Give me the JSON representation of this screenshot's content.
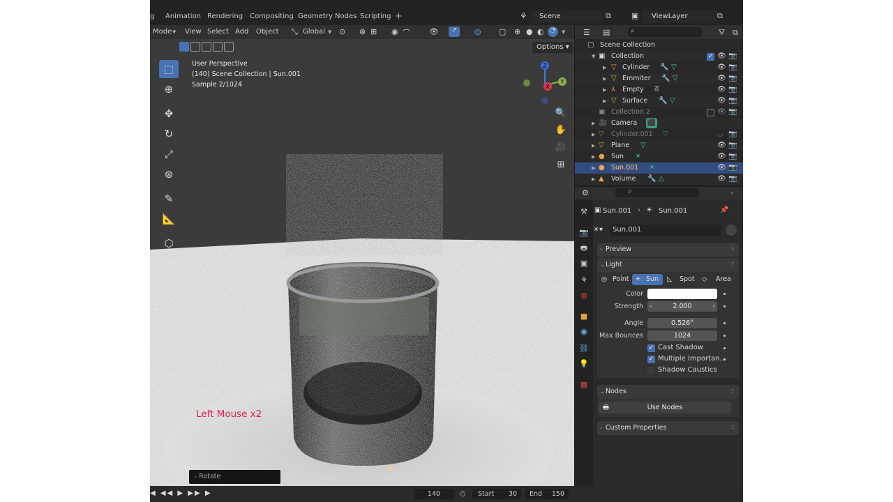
{
  "topbar": {
    "tabs": [
      "g",
      "Animation",
      "Rendering",
      "Compositing",
      "Geometry Nodes",
      "Scripting"
    ],
    "plus": "+",
    "scene": "Scene",
    "view_layer": "ViewLayer"
  },
  "viewport_header": {
    "mode": "Mode",
    "menus": [
      "View",
      "Select",
      "Add",
      "Object"
    ],
    "orientation": "Global",
    "options": "Options"
  },
  "viewport": {
    "perspective": "User Perspective",
    "collection_info": "(140) Scene Collection | Sun.001",
    "sample": "Sample 2/1024",
    "keystroke": "Left Mouse x2",
    "last_operator": "Rotate",
    "gizmo": {
      "z": "Z",
      "y": "Y",
      "x": "X"
    }
  },
  "timeline": {
    "current_frame": "140",
    "start_label": "Start",
    "start_value": "30",
    "end_label": "End",
    "end_value": "150"
  },
  "outliner": {
    "root": "Scene Collection",
    "rows": [
      {
        "name": "Collection",
        "level": 1,
        "type": "collection"
      },
      {
        "name": "Cylinder",
        "level": 2,
        "type": "mesh"
      },
      {
        "name": "Emmiter",
        "level": 2,
        "type": "mesh"
      },
      {
        "name": "Empty",
        "level": 2,
        "type": "empty"
      },
      {
        "name": "Surface",
        "level": 2,
        "type": "mesh"
      },
      {
        "name": "Collection 2",
        "level": 1,
        "type": "collection-dim"
      },
      {
        "name": "Camera",
        "level": 1,
        "type": "camera"
      },
      {
        "name": "Cylinder.001",
        "level": 1,
        "type": "mesh-dim"
      },
      {
        "name": "Plane",
        "level": 1,
        "type": "mesh"
      },
      {
        "name": "Sun",
        "level": 1,
        "type": "light"
      },
      {
        "name": "Sun.001",
        "level": 1,
        "type": "light-selected"
      },
      {
        "name": "Volume",
        "level": 1,
        "type": "mesh"
      }
    ]
  },
  "properties": {
    "breadcrumb_object": "Sun.001",
    "breadcrumb_data": "Sun.001",
    "datablock_name": "Sun.001",
    "preview_label": "Preview",
    "light_label": "Light",
    "light_types": [
      "Point",
      "Sun",
      "Spot",
      "Area"
    ],
    "active_light_type": "Sun",
    "color_label": "Color",
    "color_value": "#ffffff",
    "strength_label": "Strength",
    "strength_value": "2.000",
    "angle_label": "Angle",
    "angle_value": "0.526°",
    "max_bounces_label": "Max Bounces",
    "max_bounces_value": "1024",
    "cast_shadow_label": "Cast Shadow",
    "cast_shadow": true,
    "multiple_importance_label": "Multiple Importan...",
    "multiple_importance": true,
    "shadow_caustics_label": "Shadow Caustics",
    "shadow_caustics": false,
    "nodes_label": "Nodes",
    "use_nodes_label": "Use Nodes",
    "custom_properties_label": "Custom Properties"
  },
  "colors": {
    "accent": "#4772b3",
    "selected_row": "#334d80",
    "keystroke_text": "#e0204e",
    "mesh_icon": "#e8a040",
    "modifier_icon": "#6ab0e8",
    "data_icon": "#38c98c"
  }
}
